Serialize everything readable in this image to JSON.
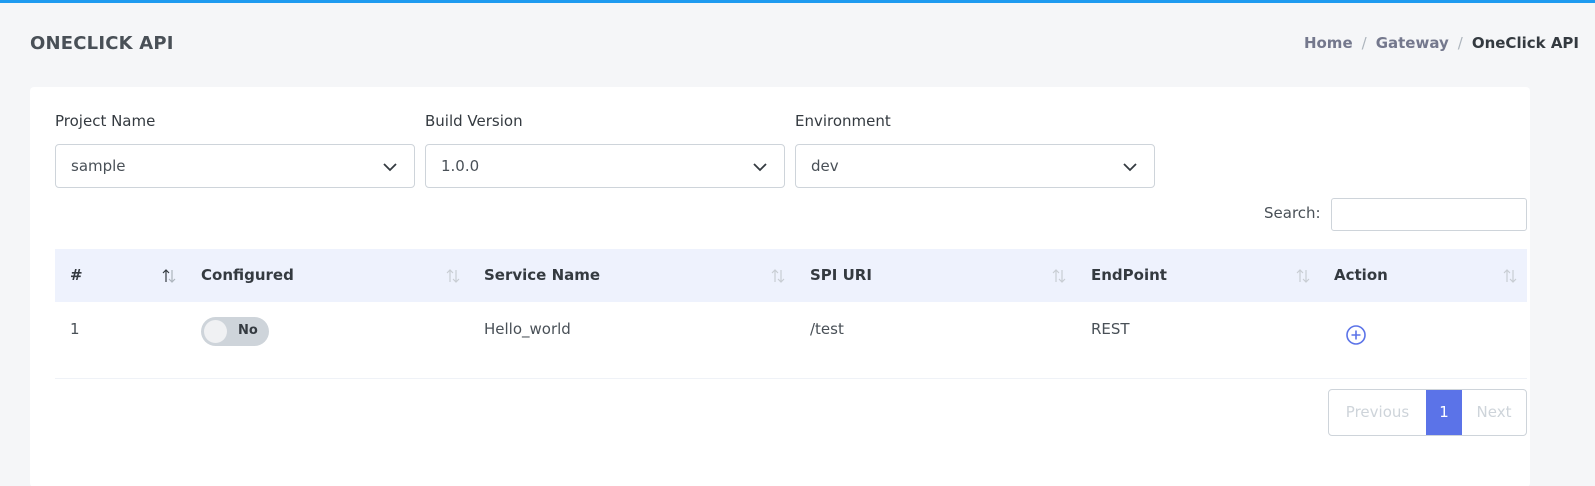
{
  "page_title": "ONECLICK API",
  "breadcrumb": [
    "Home",
    "Gateway",
    "OneClick API"
  ],
  "filters": {
    "project": {
      "label": "Project Name",
      "value": "sample"
    },
    "build": {
      "label": "Build Version",
      "value": "1.0.0"
    },
    "environment": {
      "label": "Environment",
      "value": "dev"
    }
  },
  "search": {
    "label": "Search:",
    "value": ""
  },
  "table": {
    "columns": [
      "#",
      "Configured",
      "Service Name",
      "SPI URI",
      "EndPoint",
      "Action"
    ],
    "rows": [
      {
        "index": "1",
        "configured": "No",
        "service_name": "Hello_world",
        "spi_uri": "/test",
        "endpoint": "REST"
      }
    ]
  },
  "pagination": {
    "previous": "Previous",
    "current": "1",
    "next": "Next"
  },
  "colors": {
    "accent": "#5b73e8",
    "header_bg": "#eef2fd",
    "topbar": "#1e9bf0"
  },
  "icons": {
    "select": "chevron-down-icon",
    "sort": "sort-arrows-icon",
    "action": "plus-circle-icon"
  }
}
